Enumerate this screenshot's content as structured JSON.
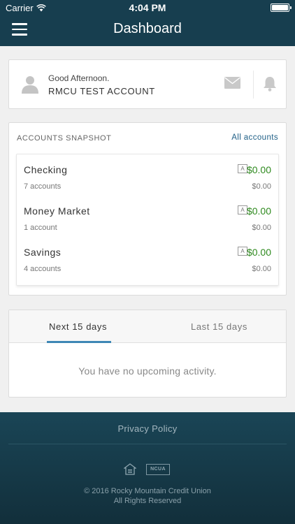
{
  "status_bar": {
    "carrier": "Carrier",
    "time": "4:04 PM"
  },
  "header": {
    "title": "Dashboard",
    "menu_icon": "hamburger-icon"
  },
  "greeting": {
    "salutation": "Good Afternoon.",
    "account_name": "RMCU TEST ACCOUNT",
    "icons": [
      "user-icon",
      "mail-icon",
      "bell-icon"
    ]
  },
  "snapshot": {
    "heading": "ACCOUNTS SNAPSHOT",
    "all_link": "All accounts",
    "accounts": [
      {
        "name": "Checking",
        "count": "7 accounts",
        "badge": "A",
        "balance": "$0.00",
        "sub_balance": "$0.00"
      },
      {
        "name": "Money Market",
        "count": "1 account",
        "badge": "A",
        "balance": "$0.00",
        "sub_balance": "$0.00"
      },
      {
        "name": "Savings",
        "count": "4 accounts",
        "badge": "A",
        "balance": "$0.00",
        "sub_balance": "$0.00"
      }
    ]
  },
  "activity": {
    "tabs": [
      "Next 15 days",
      "Last 15 days"
    ],
    "active_tab": "Next 15 days",
    "empty_message": "You have no upcoming activity."
  },
  "footer": {
    "privacy": "Privacy Policy",
    "ncua": "NCUA",
    "copyright_line1": "© 2016 Rocky Mountain Credit Union",
    "copyright_line2": "All Rights Reserved"
  },
  "colors": {
    "header_bg": "#173e4f",
    "balance_green": "#2f8a1f",
    "link_blue": "#1f5f86",
    "tab_underline": "#3e87b5"
  }
}
